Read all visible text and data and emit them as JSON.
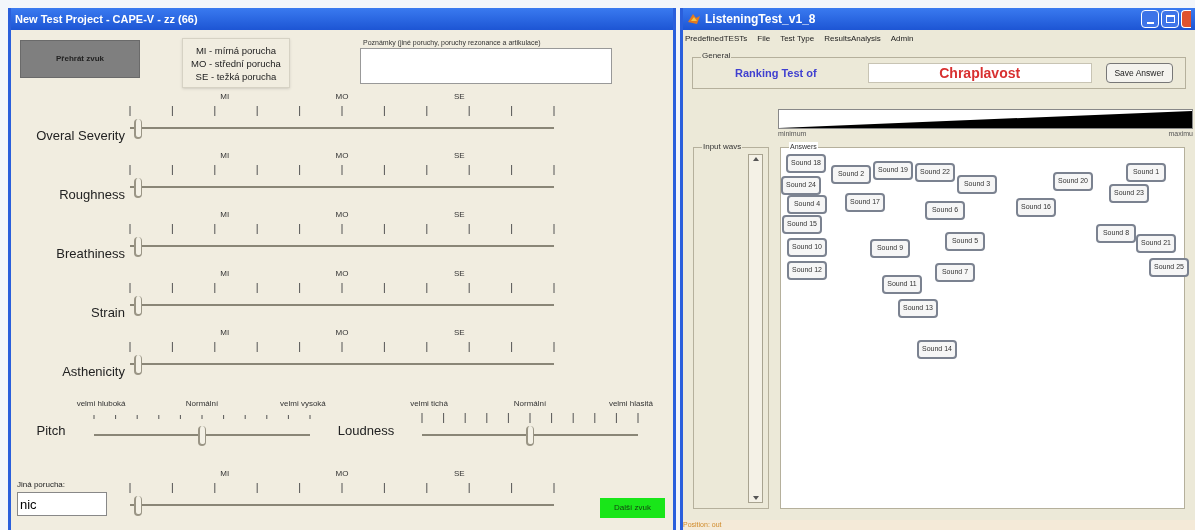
{
  "left_window": {
    "title": "New Test Project - CAPE-V - zz (66)",
    "play_button": "Přehrát zvuk",
    "legend": [
      "MI - mírná porucha",
      "MO - střední porucha",
      "SE - težká porucha"
    ],
    "notes": {
      "label": "Poznámky (jiné poruchy, poruchy rezonance a artikulace)"
    },
    "ratings": [
      {
        "label": "Overal Severity",
        "scale_labels": [
          "MI",
          "MO",
          "SE"
        ],
        "level": 0
      },
      {
        "label": "Roughness",
        "scale_labels": [
          "MI",
          "MO",
          "SE"
        ],
        "level": 0
      },
      {
        "label": "Breathiness",
        "scale_labels": [
          "MI",
          "MO",
          "SE"
        ],
        "level": 0
      },
      {
        "label": "Strain",
        "scale_labels": [
          "MI",
          "MO",
          "SE"
        ],
        "level": 0
      },
      {
        "label": "Asthenicity",
        "scale_labels": [
          "MI",
          "MO",
          "SE"
        ],
        "level": 0
      }
    ],
    "pitch": {
      "label": "Pitch",
      "scale_labels": [
        "velmi hluboká",
        "Normální",
        "velmi vysoká"
      ],
      "level": 0.5
    },
    "loudness": {
      "label": "Loudness",
      "scale_labels": [
        "velmi tichá",
        "Normální",
        "velmi hlasitá"
      ],
      "level": 0.5
    },
    "other": {
      "label": "Jiná porucha:",
      "value": "nic",
      "scale_labels": [
        "MI",
        "MO",
        "SE"
      ],
      "level": 0
    },
    "next_button": "Další zvuk"
  },
  "right_window": {
    "title": "ListeningTest_v1_8",
    "menu": [
      "PredefinedTESTs",
      "File",
      "Test Type",
      "ResultsAnalysis",
      "Admin"
    ],
    "general": {
      "legend": "General",
      "label": "Ranking Test of",
      "value": "Chraplavost",
      "button": "Save Answer"
    },
    "wedge": {
      "min_label": "minimum",
      "max_label": "maximu"
    },
    "input_waves": {
      "legend": "Input wavs"
    },
    "answers": {
      "legend": "Answers",
      "sounds": [
        "Sound 18",
        "Sound 2",
        "Sound 19",
        "Sound 22",
        "Sound 3",
        "Sound 20",
        "Sound 1",
        "Sound 23",
        "Sound 24",
        "Sound 4",
        "Sound 17",
        "Sound 6",
        "Sound 16",
        "Sound 15",
        "Sound 10",
        "Sound 9",
        "Sound 5",
        "Sound 8",
        "Sound 21",
        "Sound 25",
        "Sound 12",
        "Sound 7",
        "Sound 11",
        "Sound 13",
        "Sound 14"
      ]
    },
    "status": "Position: out"
  }
}
